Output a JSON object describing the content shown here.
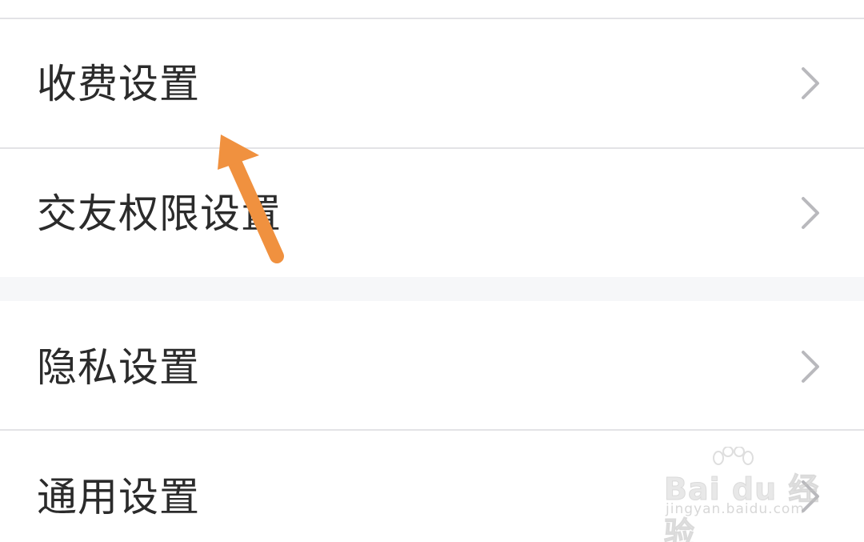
{
  "settings_list": {
    "items": [
      {
        "label": "收费设置",
        "icon": "chevron-right-icon"
      },
      {
        "label": "交友权限设置",
        "icon": "chevron-right-icon"
      },
      {
        "label": "隐私设置",
        "icon": "chevron-right-icon"
      },
      {
        "label": "通用设置",
        "icon": "chevron-right-icon"
      }
    ]
  },
  "annotation": {
    "arrow_color": "#f0913f",
    "points_to": "收费设置"
  },
  "watermark": {
    "logo_text": "Bai du 经验",
    "url": "jingyan.baidu.com"
  },
  "colors": {
    "background": "#ffffff",
    "divider": "#e3e3e6",
    "section_gap": "#f6f7f9",
    "text": "#2b2b2b",
    "chevron": "#b9b9bd"
  }
}
